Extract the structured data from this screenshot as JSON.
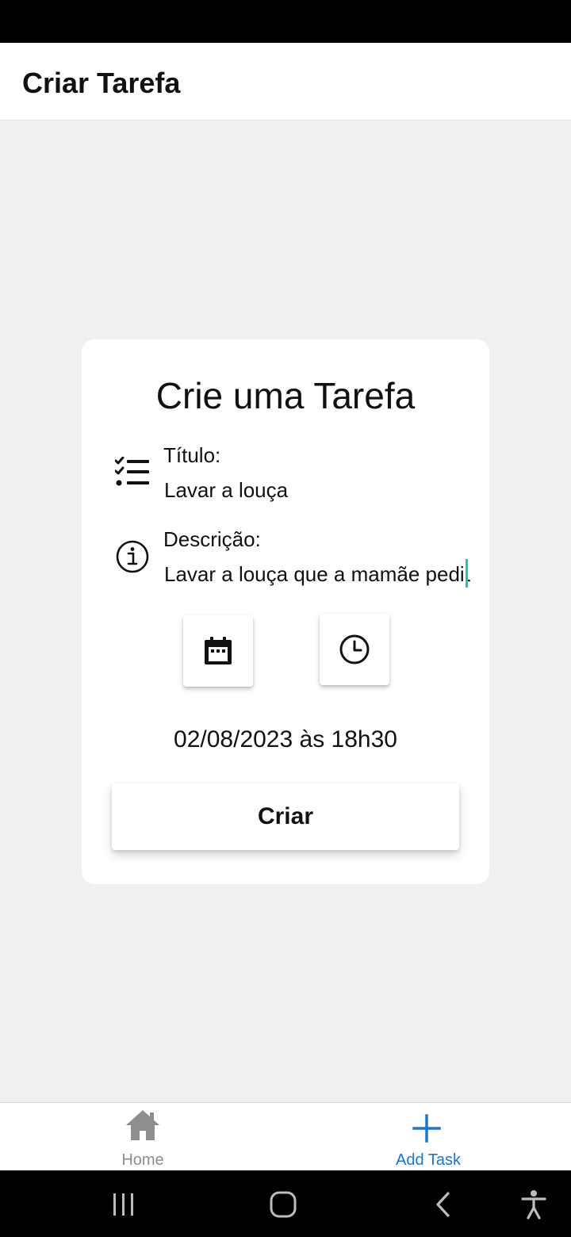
{
  "header": {
    "title": "Criar Tarefa"
  },
  "form": {
    "title": "Crie uma Tarefa",
    "title_field": {
      "label": "Título:",
      "value": "Lavar a louça",
      "icon": "checklist-icon"
    },
    "description_field": {
      "label": "Descrição:",
      "value": "Lavar a louça que a mamãe pediu",
      "icon": "info-icon"
    },
    "date_button_icon": "calendar-icon",
    "time_button_icon": "clock-icon",
    "selected_datetime": "02/08/2023 às 18h30",
    "submit_label": "Criar"
  },
  "tabs": [
    {
      "label": "Home",
      "icon": "home-icon",
      "active": false,
      "color": "#8e8e8f"
    },
    {
      "label": "Add Task",
      "icon": "plus-icon",
      "active": true,
      "color": "#1976d2"
    }
  ],
  "system_nav": {
    "icons": [
      "recent-apps-icon",
      "home-circle-icon",
      "back-icon",
      "accessibility-icon"
    ]
  },
  "colors": {
    "background": "#f0f0f0",
    "card": "#ffffff",
    "accent": "#1976d2",
    "caret": "#1bc7b8",
    "inactive": "#8e8e8f"
  }
}
